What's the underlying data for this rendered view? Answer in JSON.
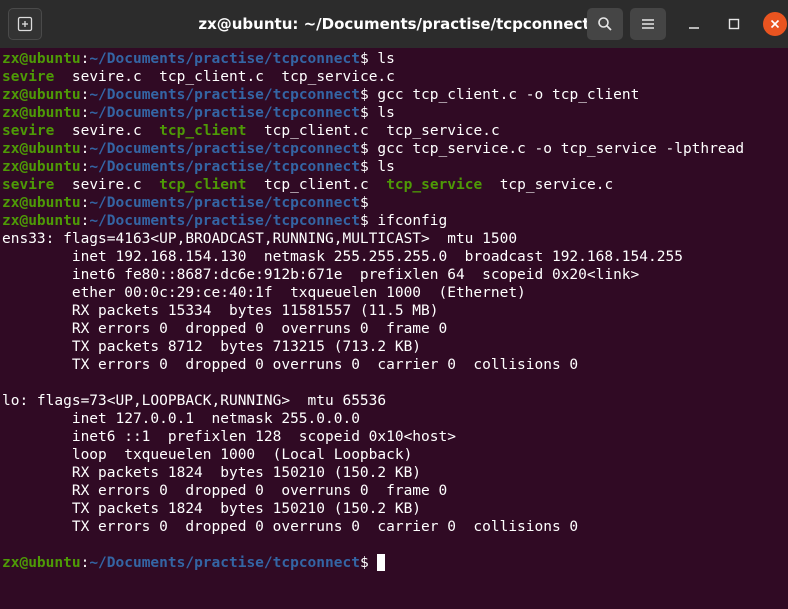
{
  "window": {
    "title": "zx@ubuntu: ~/Documents/practise/tcpconnect",
    "icons": [
      "new-tab-icon",
      "search-icon",
      "hamburger-menu-icon",
      "minimize-icon",
      "maximize-icon",
      "close-icon"
    ],
    "colors": {
      "background": "#300a24",
      "titlebar": "#2c2c2c",
      "close": "#e95420",
      "prompt_user": "#4e9a06",
      "prompt_path": "#3465a4",
      "executable": "#4e9a06"
    }
  },
  "prompt": {
    "user_host": "zx@ubuntu",
    "sep": ":",
    "path": "~/Documents/practise/tcpconnect",
    "dollar": "$ "
  },
  "terminal": {
    "cmd1": "ls",
    "ls1": {
      "f1": "sevire",
      "g1": "  ",
      "f2": "sevire.c",
      "g2": "  ",
      "f3": "tcp_client.c",
      "g3": "  ",
      "f4": "tcp_service.c"
    },
    "cmd2": "gcc tcp_client.c -o tcp_client",
    "cmd3": "ls",
    "ls2": {
      "f1": "sevire",
      "g1": "  ",
      "f2": "sevire.c",
      "g2": "  ",
      "f3": "tcp_client",
      "g3": "  ",
      "f4": "tcp_client.c",
      "g4": "  ",
      "f5": "tcp_service.c"
    },
    "cmd4": "gcc tcp_service.c -o tcp_service -lpthread",
    "cmd5": "ls",
    "ls3": {
      "f1": "sevire",
      "g1": "  ",
      "f2": "sevire.c",
      "g2": "  ",
      "f3": "tcp_client",
      "g3": "  ",
      "f4": "tcp_client.c",
      "g4": "  ",
      "f5": "tcp_service",
      "g5": "  ",
      "f6": "tcp_service.c"
    },
    "cmd6": "",
    "cmd7": "ifconfig",
    "ens33": [
      "ens33: flags=4163<UP,BROADCAST,RUNNING,MULTICAST>  mtu 1500",
      "        inet 192.168.154.130  netmask 255.255.255.0  broadcast 192.168.154.255",
      "        inet6 fe80::8687:dc6e:912b:671e  prefixlen 64  scopeid 0x20<link>",
      "        ether 00:0c:29:ce:40:1f  txqueuelen 1000  (Ethernet)",
      "        RX packets 15334  bytes 11581557 (11.5 MB)",
      "        RX errors 0  dropped 0  overruns 0  frame 0",
      "        TX packets 8712  bytes 713215 (713.2 KB)",
      "        TX errors 0  dropped 0 overruns 0  carrier 0  collisions 0"
    ],
    "lo": [
      "lo: flags=73<UP,LOOPBACK,RUNNING>  mtu 65536",
      "        inet 127.0.0.1  netmask 255.0.0.0",
      "        inet6 ::1  prefixlen 128  scopeid 0x10<host>",
      "        loop  txqueuelen 1000  (Local Loopback)",
      "        RX packets 1824  bytes 150210 (150.2 KB)",
      "        RX errors 0  dropped 0  overruns 0  frame 0",
      "        TX packets 1824  bytes 150210 (150.2 KB)",
      "        TX errors 0  dropped 0 overruns 0  carrier 0  collisions 0"
    ]
  }
}
